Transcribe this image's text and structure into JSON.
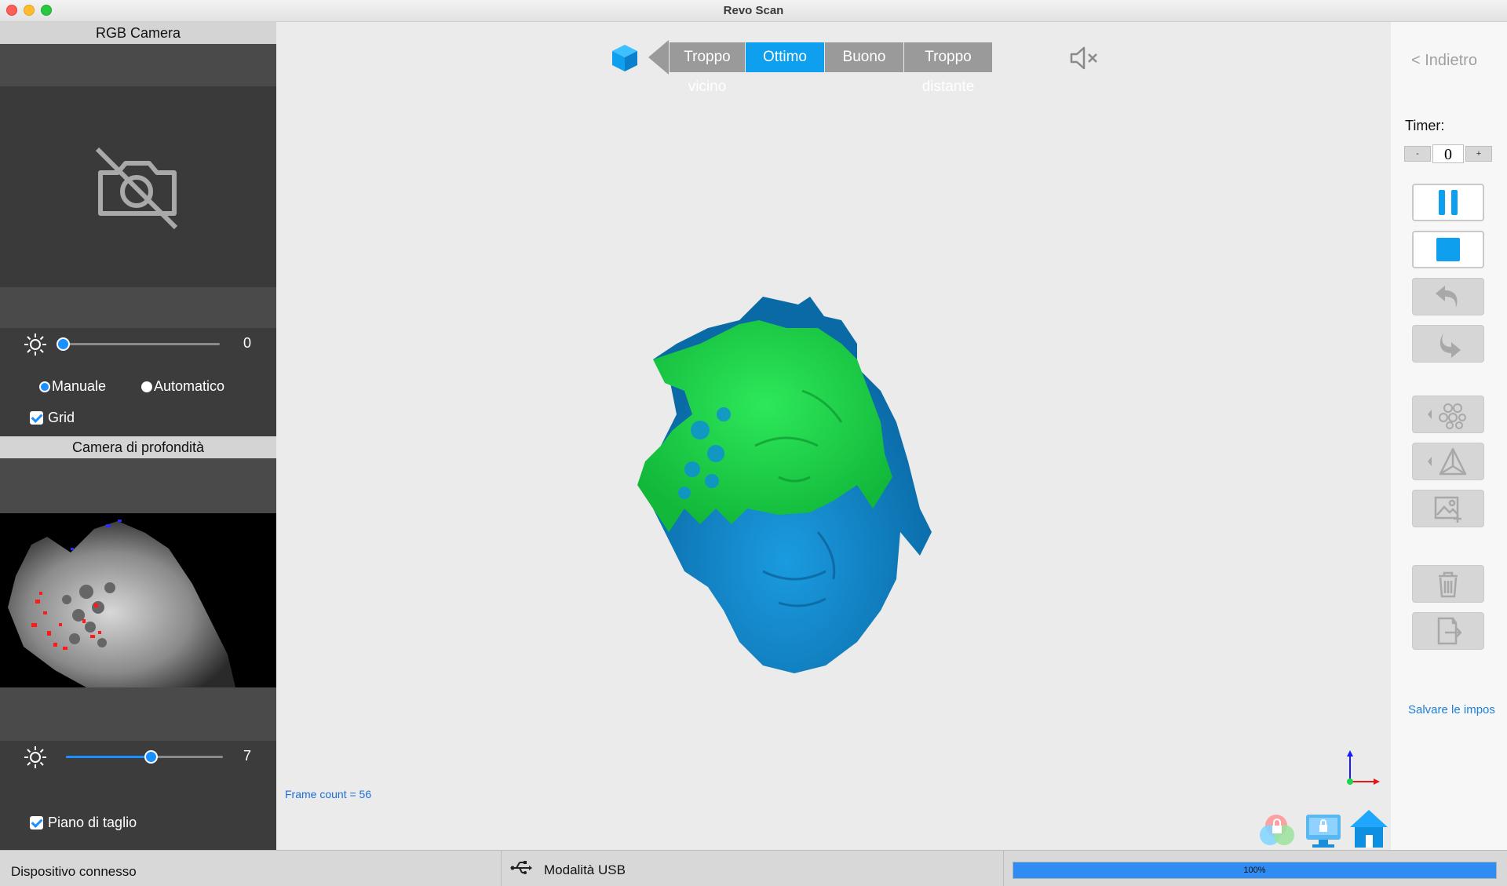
{
  "window": {
    "title": "Revo Scan"
  },
  "left_panel": {
    "rgb_header": "RGB Camera",
    "rgb_camera_icon": "camera-off-icon",
    "rgb_brightness": {
      "value": "0",
      "fraction": 0.0
    },
    "exposure_mode": {
      "manual_label": "Manuale",
      "auto_label": "Automatico",
      "selected": "Manuale"
    },
    "grid_label": "Grid",
    "grid_checked": true,
    "depth_header": "Camera di profondità",
    "depth_brightness": {
      "value": "7",
      "fraction": 0.54
    },
    "cut_plane_label": "Piano di taglio",
    "cut_plane_checked": true
  },
  "viewport": {
    "quality_segments": [
      "Troppo vicino",
      "Ottimo",
      "Buono",
      "Troppo distante"
    ],
    "quality_active": "Ottimo",
    "frame_count": "Frame count = 56",
    "colors": {
      "good": "#17d64a",
      "mesh": "#0f8fd6",
      "active": "#0ea0ee"
    }
  },
  "right_panel": {
    "back_label": "< Indietro",
    "timer_label": "Timer:",
    "timer_minus": "-",
    "timer_value": "0",
    "timer_plus": "+",
    "save_label": "Salvare le impos",
    "buttons": [
      "pause-icon",
      "stop-icon",
      "undo-icon",
      "redo-icon",
      "point-cloud-icon",
      "mesh-icon",
      "add-image-icon",
      "trash-icon",
      "export-icon"
    ]
  },
  "status_bar": {
    "device_status": "Dispositivo connesso",
    "connection_mode": "Modalità USB",
    "progress_text": "100%",
    "progress_fraction": 1.0
  }
}
